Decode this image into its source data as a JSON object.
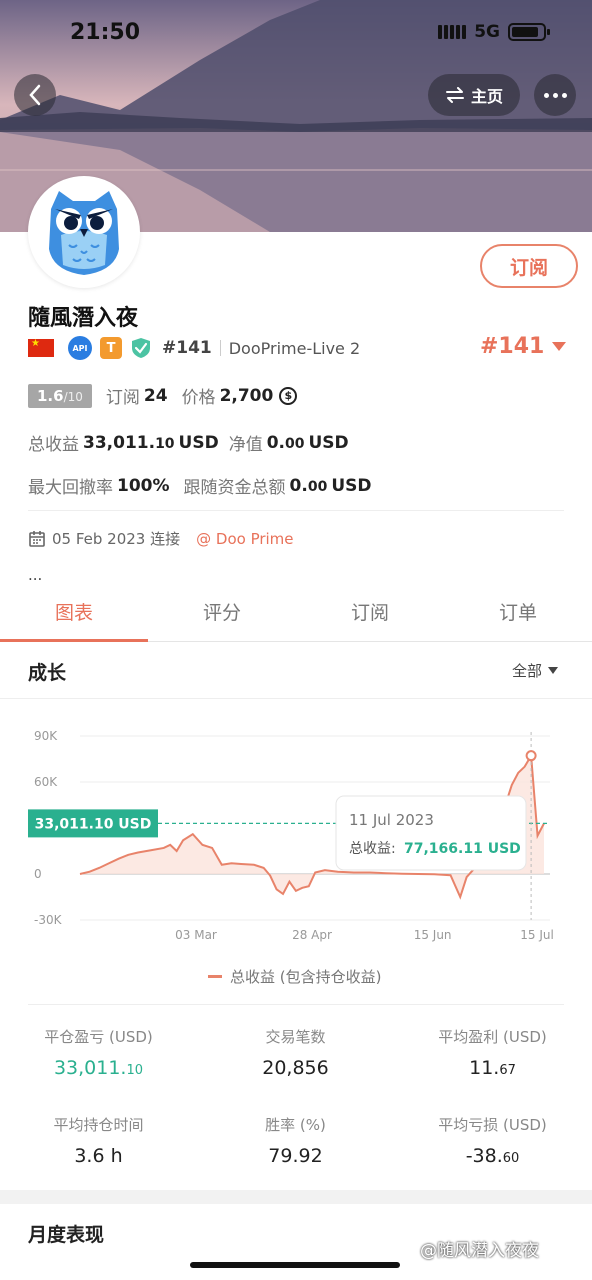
{
  "status_bar": {
    "time": "21:50",
    "network": "5G"
  },
  "header": {
    "home_label": "主页"
  },
  "profile": {
    "subscribe_label": "订阅",
    "name": "隨風潛入夜",
    "rank_small": "#141",
    "broker": "DooPrime-Live 2",
    "rank_big": "#141",
    "api_badge": "API",
    "t_badge": "T",
    "score": "1.6",
    "score_max": "/10",
    "subscribe_count_label": "订阅",
    "subscribe_count": "24",
    "price_label": "价格",
    "price": "2,700",
    "coin_symbol": "$",
    "total_profit_label": "总收益",
    "total_profit_int": "33,011.",
    "total_profit_dec": "10",
    "total_profit_unit": "USD",
    "net_value_label": "净值",
    "net_value_int": "0.",
    "net_value_dec": "00",
    "net_value_unit": "USD",
    "drawdown_label": "最大回撤率",
    "drawdown": "100%",
    "follow_fund_label": "跟随资金总额",
    "follow_fund_int": "0.",
    "follow_fund_dec": "00",
    "follow_fund_unit": "USD",
    "connect_date": "05 Feb 2023 连接",
    "connect_broker": "@ Doo Prime",
    "ellipsis": "..."
  },
  "tabs": [
    {
      "label": "图表",
      "active": true
    },
    {
      "label": "评分",
      "active": false
    },
    {
      "label": "订阅",
      "active": false
    },
    {
      "label": "订单",
      "active": false
    }
  ],
  "growth": {
    "title": "成长",
    "filter": "全部"
  },
  "chart_data": {
    "type": "area",
    "yticks": [
      "90K",
      "60K",
      "0",
      "-30K"
    ],
    "yticks_vals": [
      90000,
      60000,
      0,
      -30000
    ],
    "xticks": [
      "03 Mar",
      "28 Apr",
      "15 Jun",
      "15 Jul"
    ],
    "ylim": [
      -30000,
      90000
    ],
    "current_label": "33,011.10 USD",
    "current_value": 33011.1,
    "tooltip": {
      "date": "11 Jul 2023",
      "label": "总收益:",
      "value": "77,166.11 USD"
    },
    "legend": "总收益 (包含持仓收益)",
    "color": "#e8836a",
    "series": [
      {
        "values": [
          [
            0,
            0
          ],
          [
            3,
            1500
          ],
          [
            6,
            4000
          ],
          [
            9,
            7000
          ],
          [
            12,
            10000
          ],
          [
            15,
            12500
          ],
          [
            18,
            14000
          ],
          [
            22,
            15500
          ],
          [
            26,
            17000
          ],
          [
            28,
            19000
          ],
          [
            30,
            15000
          ],
          [
            32,
            22000
          ],
          [
            35,
            26000
          ],
          [
            38,
            19000
          ],
          [
            41,
            17000
          ],
          [
            44,
            6000
          ],
          [
            47,
            7000
          ],
          [
            50,
            6500
          ],
          [
            54,
            6000
          ],
          [
            57,
            4000
          ],
          [
            59,
            -1000
          ],
          [
            61,
            -10000
          ],
          [
            63,
            -13000
          ],
          [
            65,
            -5000
          ],
          [
            67,
            -11000
          ],
          [
            69,
            -9000
          ],
          [
            71,
            -8000
          ],
          [
            73,
            1000
          ],
          [
            76,
            2500
          ],
          [
            80,
            1500
          ],
          [
            85,
            1000
          ],
          [
            90,
            1000
          ],
          [
            95,
            500
          ],
          [
            100,
            200
          ],
          [
            105,
            0
          ],
          [
            110,
            -200
          ],
          [
            115,
            -800
          ],
          [
            118,
            -15000
          ],
          [
            120,
            -2000
          ],
          [
            123,
            5000
          ],
          [
            126,
            12000
          ],
          [
            129,
            28000
          ],
          [
            132,
            45000
          ],
          [
            134,
            58000
          ],
          [
            136,
            66000
          ],
          [
            138,
            70000
          ],
          [
            140,
            77166
          ],
          [
            142,
            25000
          ],
          [
            144,
            33011
          ]
        ]
      }
    ]
  },
  "stats": [
    {
      "label": "平仓盈亏 (USD)",
      "value_int": "33,011.",
      "value_dec": "10",
      "green": true
    },
    {
      "label": "交易笔数",
      "value_int": "20,856",
      "value_dec": "",
      "green": false
    },
    {
      "label": "平均盈利 (USD)",
      "value_int": "11.",
      "value_dec": "67",
      "green": false
    },
    {
      "label": "平均持仓时间",
      "value_int": "3.6 h",
      "value_dec": "",
      "green": false
    },
    {
      "label": "胜率 (%)",
      "value_int": "79.92",
      "value_dec": "",
      "green": false
    },
    {
      "label": "平均亏损 (USD)",
      "value_int": "-38.",
      "value_dec": "60",
      "green": false
    }
  ],
  "monthly": {
    "title": "月度表现"
  },
  "watermark": "@随风潜入夜夜"
}
